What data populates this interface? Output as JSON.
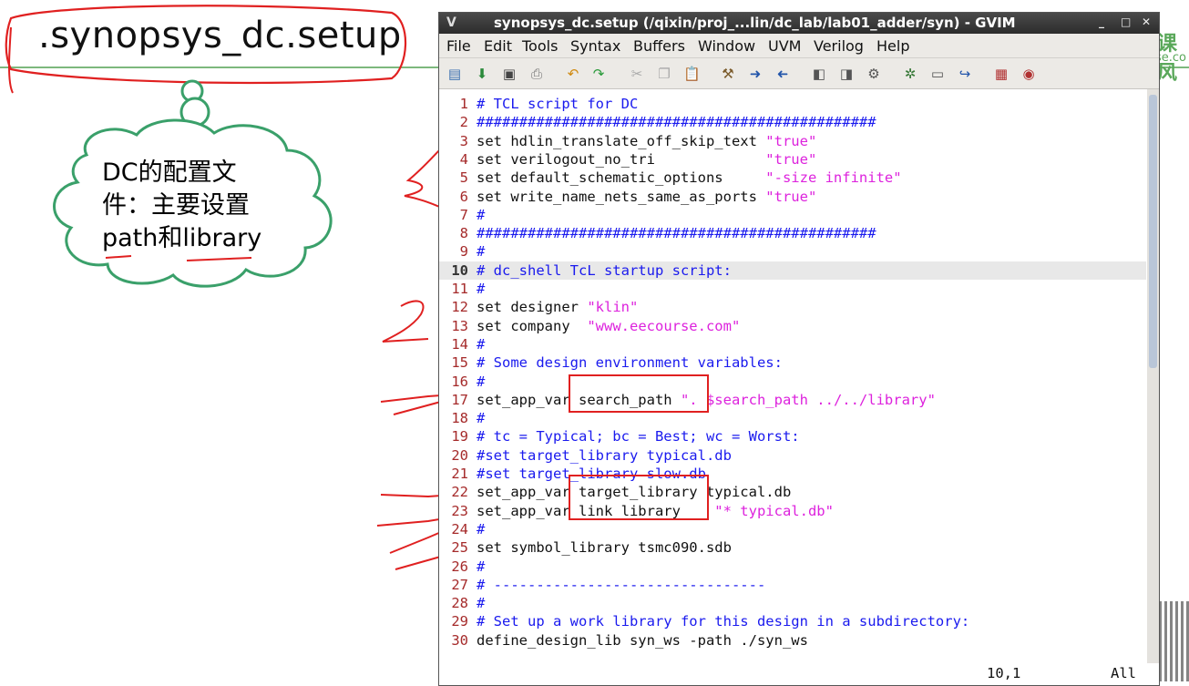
{
  "slide": {
    "title": ".synopsys_dc.setup",
    "note_lines": [
      "DC的配置文",
      "件：主要设置",
      "path和library"
    ],
    "watermark": "课风",
    "watermark2": "se.co"
  },
  "window": {
    "title": "synopsys_dc.setup (/qixin/proj_...lin/dc_lab/lab01_adder/syn) - GVIM",
    "menu": [
      "File",
      "Edit",
      "Tools",
      "Syntax",
      "Buffers",
      "Window",
      "UVM",
      "Verilog",
      "Help"
    ],
    "controls": [
      "_",
      "□",
      "✕"
    ]
  },
  "toolbar_icons": [
    "open-icon",
    "save-icon",
    "save-all-icon",
    "print-icon",
    "undo-icon",
    "redo-icon",
    "cut-icon",
    "copy-icon",
    "paste-icon",
    "find-replace-icon",
    "find-next-icon",
    "find-prev-icon",
    "load-session-icon",
    "save-session-icon",
    "run-script-icon",
    "make-icon",
    "shell-icon",
    "jump-tag-icon",
    "help-icon",
    "find-help-icon"
  ],
  "editor": {
    "lines": [
      {
        "n": "1",
        "text": "# TCL script for DC",
        "kind": "comment"
      },
      {
        "n": "2",
        "text": "###############################################",
        "kind": "comment"
      },
      {
        "n": "3",
        "text": "set hdlin_translate_off_skip_text ",
        "str": "\"true\"",
        "kind": "mixed"
      },
      {
        "n": "4",
        "text": "set verilogout_no_tri             ",
        "str": "\"true\"",
        "kind": "mixed"
      },
      {
        "n": "5",
        "text": "set default_schematic_options     ",
        "str": "\"-size infinite\"",
        "kind": "mixed"
      },
      {
        "n": "6",
        "text": "set write_name_nets_same_as_ports ",
        "str": "\"true\"",
        "kind": "mixed"
      },
      {
        "n": "7",
        "text": "#",
        "kind": "comment"
      },
      {
        "n": "8",
        "text": "###############################################",
        "kind": "comment"
      },
      {
        "n": "9",
        "text": "#",
        "kind": "comment"
      },
      {
        "n": "10",
        "text": "# dc_shell TcL startup script:",
        "kind": "comment"
      },
      {
        "n": "11",
        "text": "#",
        "kind": "comment"
      },
      {
        "n": "12",
        "text": "set designer ",
        "str": "\"klin\"",
        "kind": "mixed"
      },
      {
        "n": "13",
        "text": "set company  ",
        "str": "\"www.eecourse.com\"",
        "kind": "mixed"
      },
      {
        "n": "14",
        "text": "#",
        "kind": "comment"
      },
      {
        "n": "15",
        "text": "# Some design environment variables:",
        "kind": "comment"
      },
      {
        "n": "16",
        "text": "#",
        "kind": "comment"
      },
      {
        "n": "17",
        "text": "set_app_var search_path ",
        "str": "\". $search_path ../../library\"",
        "kind": "mixed"
      },
      {
        "n": "18",
        "text": "#",
        "kind": "comment"
      },
      {
        "n": "19",
        "text": "# tc = Typical; bc = Best; wc = Worst:",
        "kind": "comment"
      },
      {
        "n": "20",
        "text": "#set target_library typical.db",
        "kind": "comment"
      },
      {
        "n": "21",
        "text": "#set target_library slow.db",
        "kind": "comment"
      },
      {
        "n": "22",
        "text": "set_app_var target_library typical.db",
        "kind": "plain"
      },
      {
        "n": "23",
        "text": "set_app_var link_library    ",
        "str": "\"* typical.db\"",
        "kind": "mixed"
      },
      {
        "n": "24",
        "text": "#",
        "kind": "comment"
      },
      {
        "n": "25",
        "text": "set symbol_library tsmc090.sdb",
        "kind": "plain"
      },
      {
        "n": "26",
        "text": "#",
        "kind": "comment"
      },
      {
        "n": "27",
        "text": "# --------------------------------",
        "kind": "comment"
      },
      {
        "n": "28",
        "text": "#",
        "kind": "comment"
      },
      {
        "n": "29",
        "text": "# Set up a work library for this design in a subdirectory:",
        "kind": "comment"
      },
      {
        "n": "30",
        "text": "define_design_lib syn_ws -path ./syn_ws",
        "kind": "plain"
      }
    ],
    "cursor_line": "10"
  },
  "status": {
    "position": "10,1",
    "scroll": "All"
  }
}
